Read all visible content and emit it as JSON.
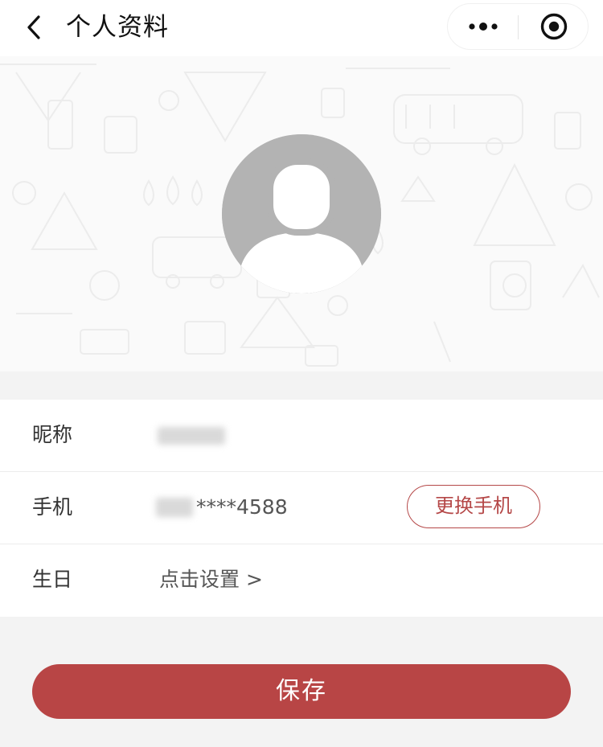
{
  "nav": {
    "title": "个人资料",
    "back_icon": "chevron-left-icon",
    "more_icon": "more-dots-icon",
    "close_icon": "target-circle-icon"
  },
  "profile": {
    "avatar_icon": "default-avatar-icon"
  },
  "form": {
    "nickname": {
      "label": "昵称",
      "value_obscured": true
    },
    "phone": {
      "label": "手机",
      "value": "****4588",
      "change_button": "更换手机"
    },
    "birthday": {
      "label": "生日",
      "value": "点击设置 >"
    }
  },
  "save_button": "保存",
  "colors": {
    "accent": "#b84545",
    "background": "#f3f3f3"
  }
}
